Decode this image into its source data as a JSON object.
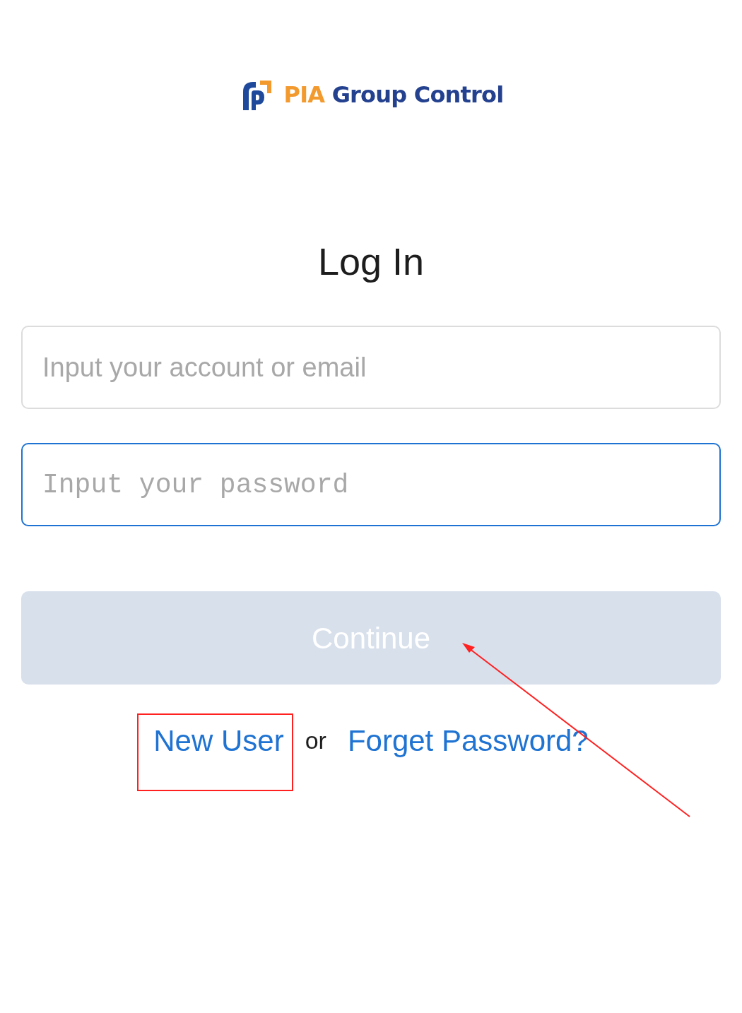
{
  "logo": {
    "accent": "PIA",
    "name": "Group Control"
  },
  "title": "Log In",
  "fields": [
    {
      "placeholder": "Input your account or email",
      "kind": "text",
      "focused": false
    },
    {
      "placeholder": "Input your password",
      "kind": "password",
      "focused": true
    }
  ],
  "continue_button": {
    "label": "Continue",
    "disabled": true
  },
  "links": [
    {
      "kind": "link",
      "text": "New User"
    },
    {
      "kind": "separator",
      "text": "or"
    },
    {
      "kind": "link",
      "text": "Forget Password?"
    }
  ]
}
